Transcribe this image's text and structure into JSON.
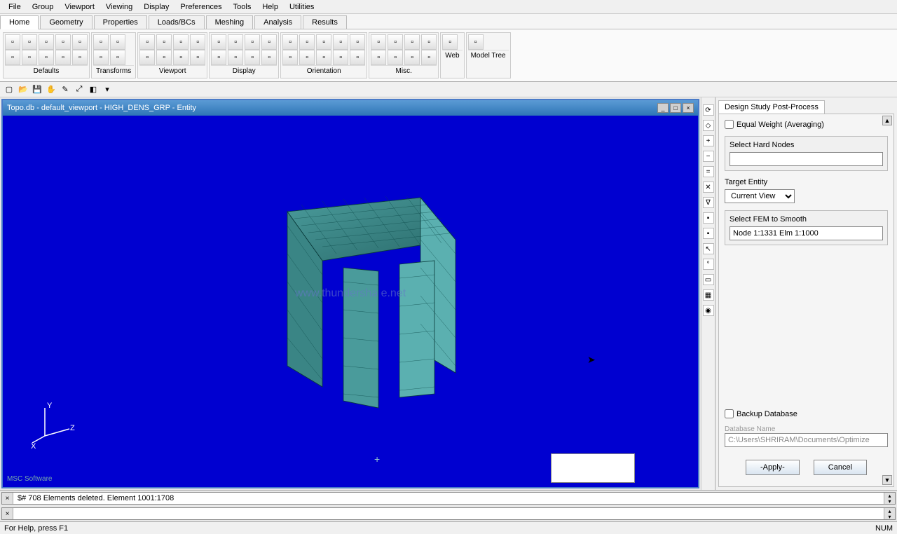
{
  "menu": {
    "items": [
      "File",
      "Group",
      "Viewport",
      "Viewing",
      "Display",
      "Preferences",
      "Tools",
      "Help",
      "Utilities"
    ]
  },
  "tabs": {
    "items": [
      "Home",
      "Geometry",
      "Properties",
      "Loads/BCs",
      "Meshing",
      "Analysis",
      "Results"
    ],
    "active": 0
  },
  "ribbon_groups": [
    {
      "name": "Defaults",
      "rows": 2,
      "cols": 5
    },
    {
      "name": "Transforms",
      "rows": 2,
      "cols": 2
    },
    {
      "name": "Viewport",
      "rows": 2,
      "cols": 4
    },
    {
      "name": "Display",
      "rows": 2,
      "cols": 4
    },
    {
      "name": "Orientation",
      "rows": 2,
      "cols": 5
    },
    {
      "name": "Misc.",
      "rows": 2,
      "cols": 4
    },
    {
      "name": "Web",
      "rows": 1,
      "cols": 1
    },
    {
      "name": "Model Tree",
      "rows": 1,
      "cols": 1
    }
  ],
  "viewport": {
    "title": "Topo.db - default_viewport - HIGH_DENS_GRP - Entity",
    "watermark": "www.thundersha e.net",
    "brand": "MSC Software",
    "axes": {
      "x": "X",
      "y": "Y",
      "z": "Z"
    }
  },
  "cmd": {
    "history": "$# 708 Elements deleted. Element 1001:1708",
    "input": ""
  },
  "statusbar": {
    "help": "For Help, press F1",
    "num": "NUM"
  },
  "panel": {
    "title": "Design Study Post-Process",
    "equal_weight": "Equal Weight (Averaging)",
    "hard_nodes_label": "Select Hard Nodes",
    "hard_nodes_value": "",
    "target_entity_label": "Target Entity",
    "target_entity_value": "Current View",
    "fem_label": "Select FEM to Smooth",
    "fem_value": "Node 1:1331 Elm 1:1000",
    "backup_label": "Backup Database",
    "db_name_label": "Database Name",
    "db_name_value": "C:\\Users\\SHRIRAM\\Documents\\Optimize",
    "apply": "-Apply-",
    "cancel": "Cancel"
  }
}
